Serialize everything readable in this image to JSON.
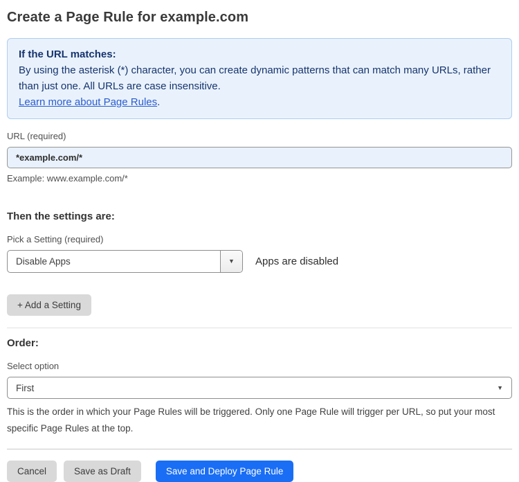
{
  "page": {
    "title": "Create a Page Rule for example.com"
  },
  "info_box": {
    "heading": "If the URL matches:",
    "body": "By using the asterisk (*) character, you can create dynamic patterns that can match many URLs, rather than just one. All URLs are case insensitive.",
    "link_label": "Learn more about Page Rules",
    "link_suffix": "."
  },
  "url_field": {
    "label": "URL (required)",
    "value": "*example.com/*",
    "helper": "Example: www.example.com/*"
  },
  "settings": {
    "heading": "Then the settings are:",
    "picker_label": "Pick a Setting (required)",
    "selected_value": "Disable Apps",
    "caret": "▼",
    "status_text": "Apps are disabled",
    "add_button_label": "+ Add a Setting"
  },
  "order": {
    "heading": "Order:",
    "select_label": "Select option",
    "selected_value": "First",
    "caret": "▼",
    "helper": "This is the order in which your Page Rules will be triggered. Only one Page Rule will trigger per URL, so put your most specific Page Rules at the top."
  },
  "footer": {
    "cancel_label": "Cancel",
    "save_draft_label": "Save as Draft",
    "save_deploy_label": "Save and Deploy Page Rule"
  },
  "colors": {
    "primary_button": "#1a6ef5",
    "info_background": "#e9f2fc",
    "info_border": "#afccf0",
    "info_text": "#17346e",
    "link": "#2a5cd0",
    "input_background": "#e9f1fc",
    "secondary_button": "#d9d9d9"
  }
}
